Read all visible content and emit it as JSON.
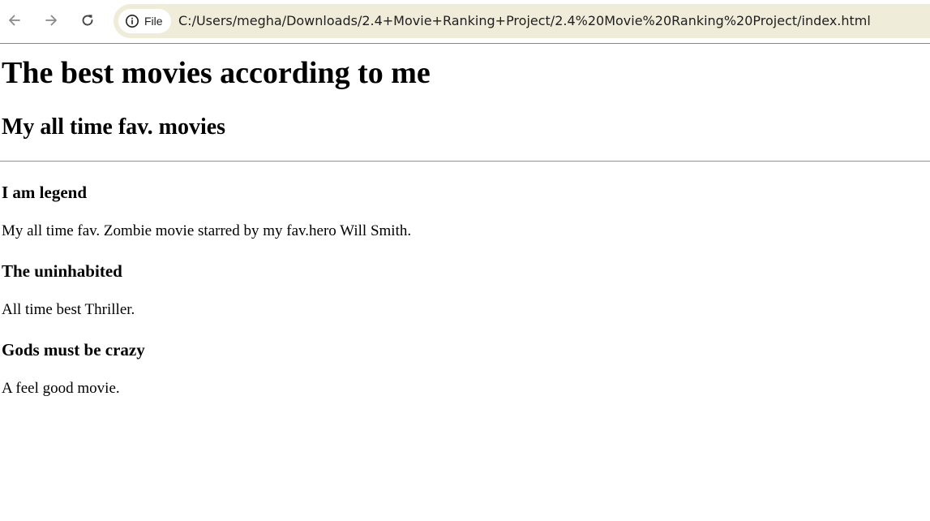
{
  "browser": {
    "chip_label": "File",
    "url": "C:/Users/megha/Downloads/2.4+Movie+Ranking+Project/2.4%20Movie%20Ranking%20Project/index.html",
    "icons": {
      "back": "arrow-back-icon",
      "forward": "arrow-forward-icon",
      "reload": "reload-icon",
      "info": "info-icon"
    },
    "colors": {
      "omnibox_bg": "#efecd9",
      "nav_disabled": "#8a8a8a",
      "nav_enabled": "#444444"
    }
  },
  "page": {
    "heading": "The best movies according to me",
    "subheading": "My all time fav. movies",
    "movies": [
      {
        "title": "I am legend",
        "description": "My all time fav. Zombie movie starred by my fav.hero Will Smith."
      },
      {
        "title": "The uninhabited",
        "description": "All time best Thriller."
      },
      {
        "title": "Gods must be crazy",
        "description": "A feel good movie."
      }
    ]
  }
}
